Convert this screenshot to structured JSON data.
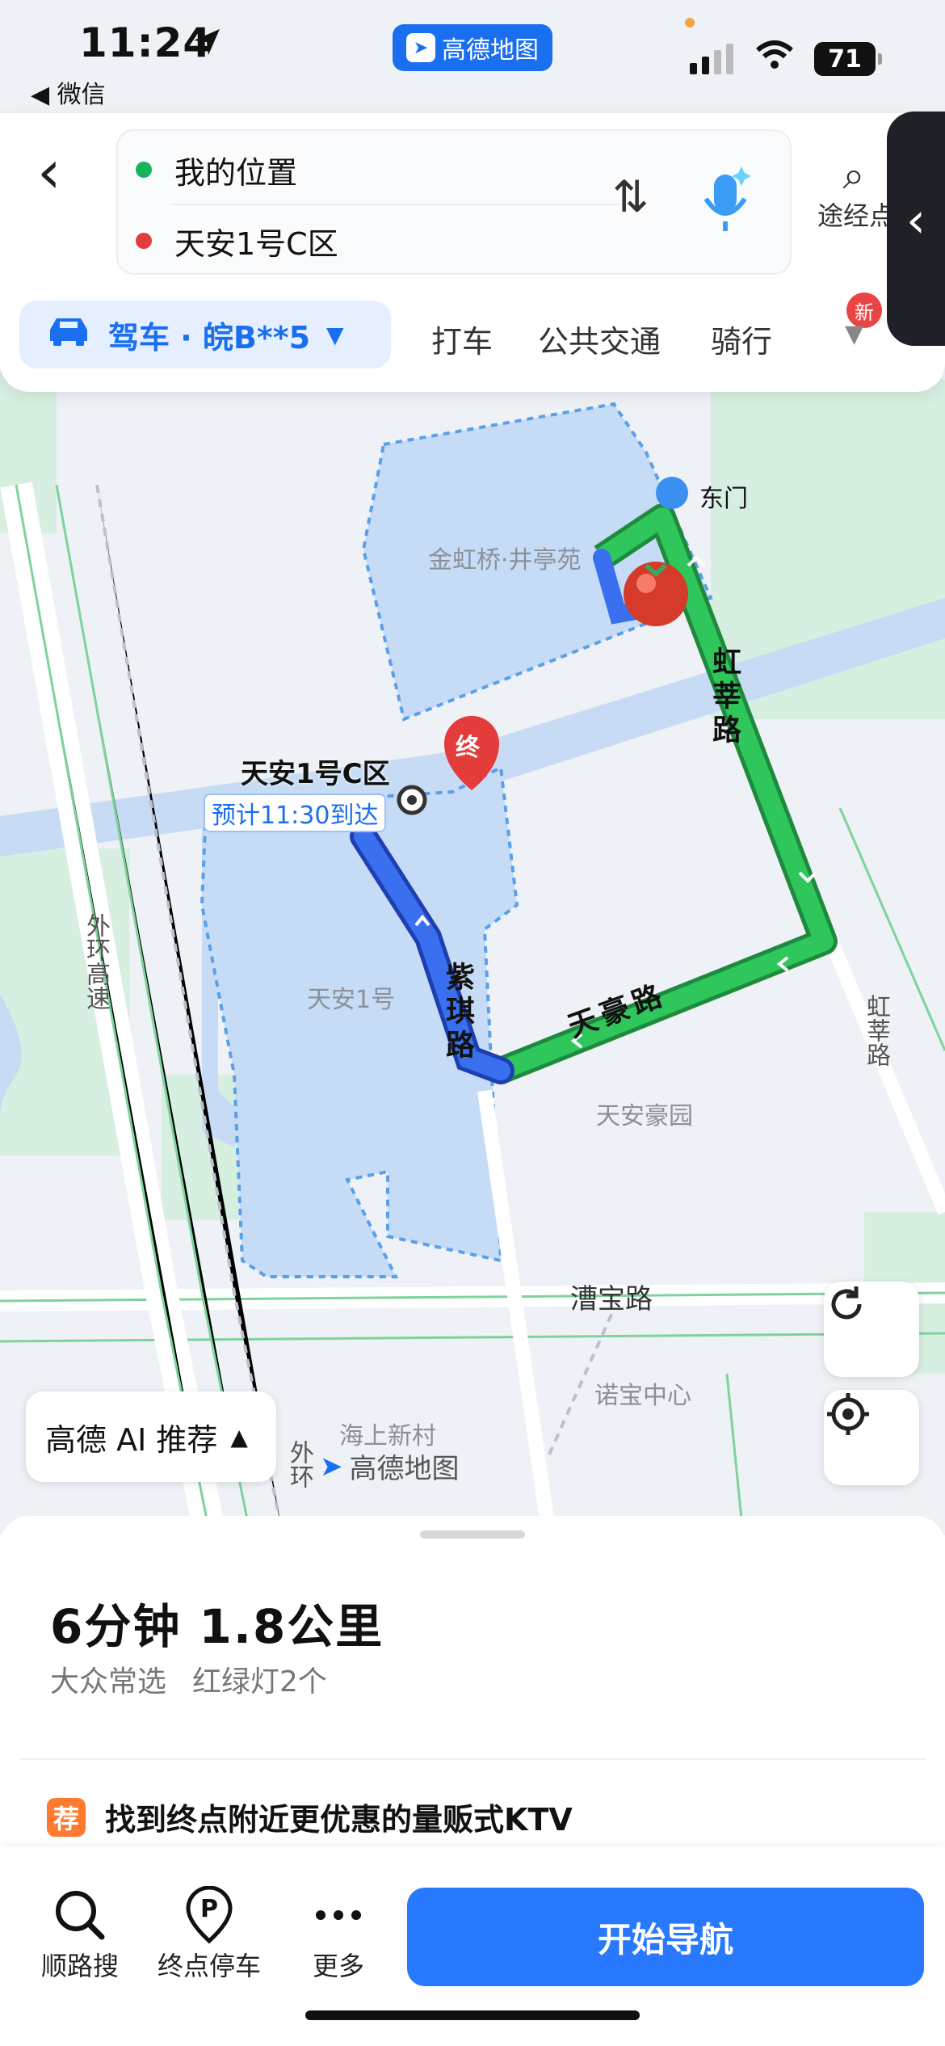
{
  "status_bar": {
    "time": "11:24",
    "back_app": "◀ 微信",
    "app_pill": "高德地图",
    "battery": "71"
  },
  "route": {
    "from": "我的位置",
    "to": "天安1号C区",
    "via": "途经点",
    "colors": {
      "from_dot": "#19b35c",
      "to_dot": "#e33c3c"
    }
  },
  "modes": {
    "selected": "驾车 · 皖B**5",
    "items": [
      "打车",
      "公共交通",
      "骑行"
    ],
    "new_badge": "新"
  },
  "map": {
    "labels": {
      "destination": "天安1号C区",
      "arrive": "预计11:30到达",
      "end_marker": "终",
      "east_gate": "东门",
      "jinhongqiao": "金虹桥·井亭苑",
      "tianan1": "天安1号",
      "tianhaoyuan": "天安豪园",
      "nuobao": "诺宝中心",
      "haishang": "海上新村",
      "waihuan": "外环高速",
      "waihuan2": "外环",
      "hongxin_road": "虹莘路",
      "hongxin_road2": "虹莘路",
      "tianhao_road": "天豪路",
      "ziqi_road": "紫琪路",
      "caobao_road": "漕宝路"
    },
    "ai_button": "高德 AI 推荐",
    "watermark": "高德地图"
  },
  "summary": {
    "eta": "6分钟  1.8公里",
    "tag": "大众常选",
    "lights": "红绿灯2个"
  },
  "recommend": {
    "tag": "荐",
    "text": "找到终点附近更优惠的量贩式KTV"
  },
  "actions": {
    "search_along": "顺路搜",
    "parking": "终点停车",
    "more": "更多",
    "start": "开始导航"
  }
}
